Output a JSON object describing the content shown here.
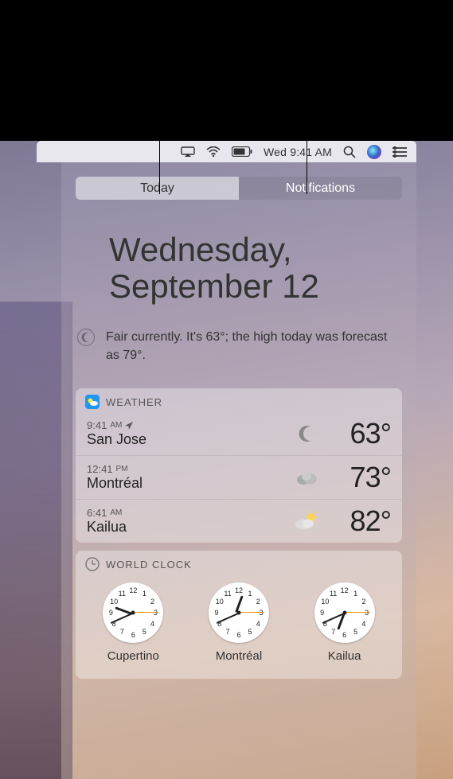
{
  "menubar": {
    "clock": "Wed 9:41 AM"
  },
  "tabs": {
    "today": "Today",
    "notifications": "Notifications"
  },
  "date": {
    "line1": "Wednesday,",
    "line2": "September 12"
  },
  "dnd_summary": "Fair currently. It's 63°; the high today was forecast as 79°.",
  "weather": {
    "title": "WEATHER",
    "items": [
      {
        "time": "9:41",
        "ampm": "AM",
        "local": true,
        "city": "San Jose",
        "icon": "moon",
        "temp": "63°"
      },
      {
        "time": "12:41",
        "ampm": "PM",
        "local": false,
        "city": "Montréal",
        "icon": "cloud",
        "temp": "73°"
      },
      {
        "time": "6:41",
        "ampm": "AM",
        "local": false,
        "city": "Kailua",
        "icon": "partly-sunny",
        "temp": "82°"
      }
    ]
  },
  "world_clock": {
    "title": "WORLD CLOCK",
    "clocks": [
      {
        "city": "Cupertino",
        "hour": 9,
        "minute": 41,
        "second": 15
      },
      {
        "city": "Montréal",
        "hour": 12,
        "minute": 41,
        "second": 15
      },
      {
        "city": "Kailua",
        "hour": 6,
        "minute": 41,
        "second": 15
      }
    ]
  }
}
